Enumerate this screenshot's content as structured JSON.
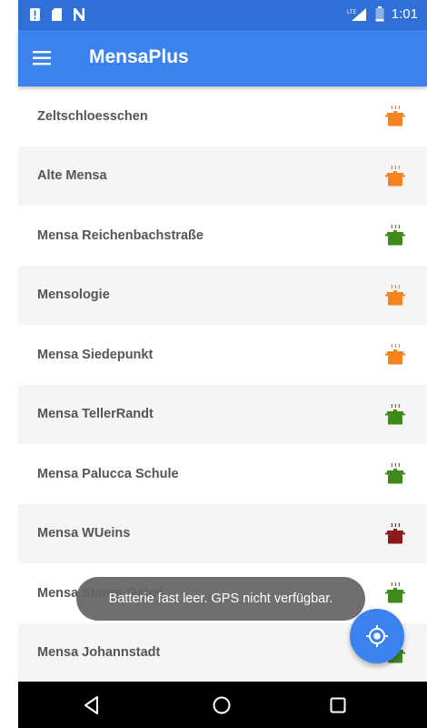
{
  "status_bar": {
    "network_label": "LTE",
    "time": "1:01",
    "color": "#2f6fd6"
  },
  "app_bar": {
    "title": "MensaPlus",
    "color": "#3b82ee"
  },
  "mensa_list": [
    {
      "name": "Zeltschloesschen",
      "status": "busy",
      "pot_color": "#f5831f"
    },
    {
      "name": "Alte Mensa",
      "status": "busy",
      "pot_color": "#f5831f"
    },
    {
      "name": "Mensa Reichenbachstraße",
      "status": "open",
      "pot_color": "#3e8a1a"
    },
    {
      "name": "Mensologie",
      "status": "busy",
      "pot_color": "#f5831f"
    },
    {
      "name": "Mensa Siedepunkt",
      "status": "busy",
      "pot_color": "#f5831f"
    },
    {
      "name": "Mensa TellerRandt",
      "status": "open",
      "pot_color": "#3e8a1a"
    },
    {
      "name": "Mensa Palucca Schule",
      "status": "open",
      "pot_color": "#3e8a1a"
    },
    {
      "name": "Mensa WUeins",
      "status": "closed",
      "pot_color": "#8b1a1a"
    },
    {
      "name": "Mensa Stimm-Gabel",
      "status": "open",
      "pot_color": "#3e8a1a"
    },
    {
      "name": "Mensa Johannstadt",
      "status": "open",
      "pot_color": "#3e8a1a"
    }
  ],
  "toast": {
    "message": "Batterie fast leer. GPS nicht verfügbar."
  },
  "fab": {
    "icon": "my-location-icon"
  },
  "nav_bar": {
    "back_icon": "back-triangle-icon",
    "home_icon": "home-circle-icon",
    "recents_icon": "recents-square-icon"
  }
}
